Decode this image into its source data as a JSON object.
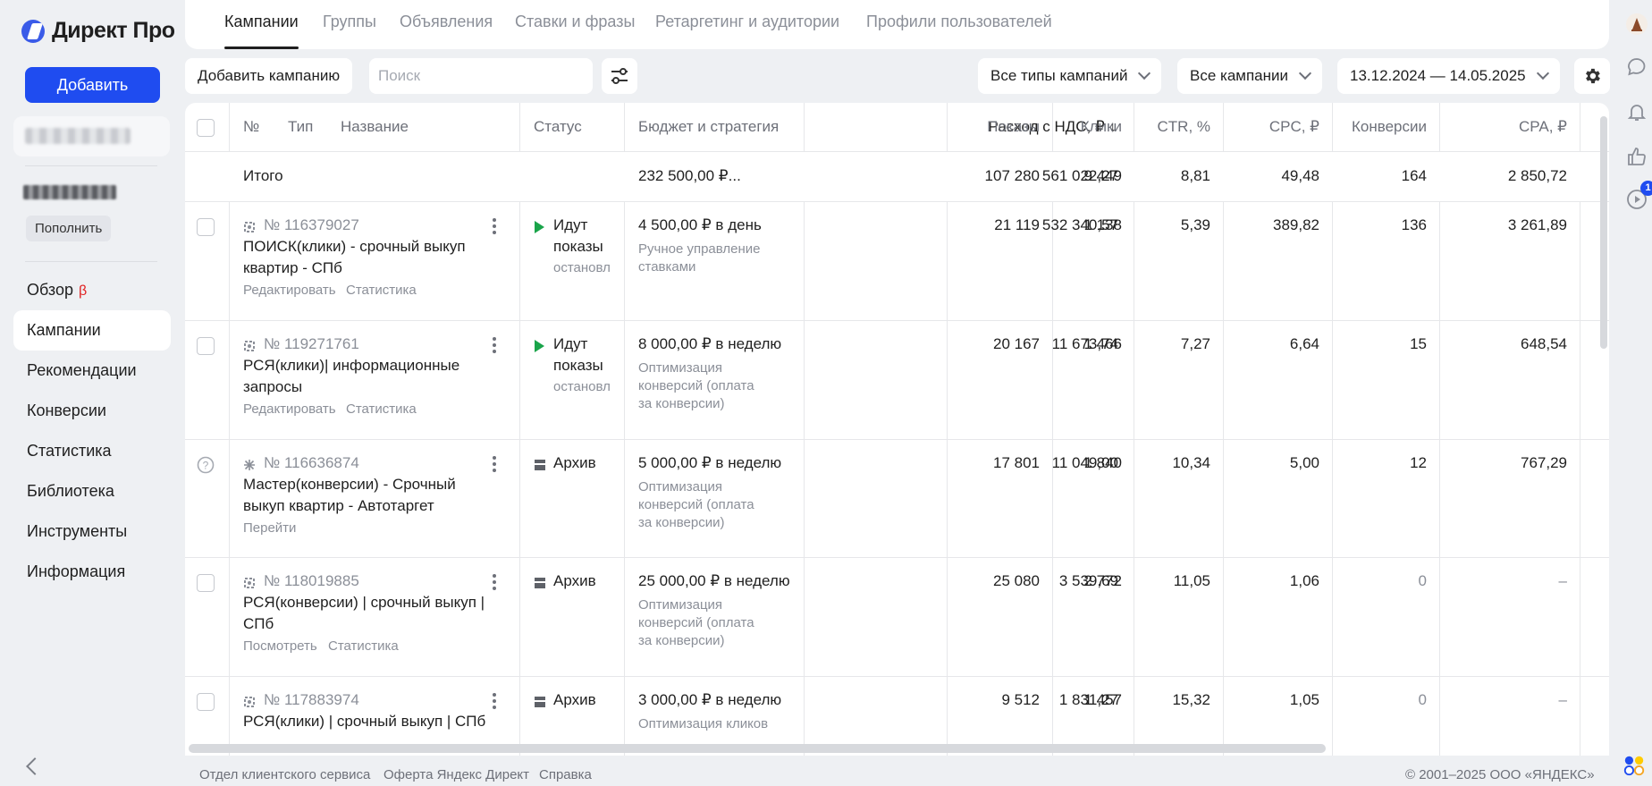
{
  "app": {
    "logo_text": "Директ Про",
    "add_button": "Добавить",
    "topup_button": "Пополнить"
  },
  "sidebar": {
    "items": [
      {
        "label": "Обзор",
        "badge": "β"
      },
      {
        "label": "Кампании",
        "active": true
      },
      {
        "label": "Рекомендации"
      },
      {
        "label": "Конверсии"
      },
      {
        "label": "Статистика"
      },
      {
        "label": "Библиотека"
      },
      {
        "label": "Инструменты"
      },
      {
        "label": "Информация"
      }
    ]
  },
  "tabs": [
    "Кампании",
    "Группы",
    "Объявления",
    "Ставки и фразы",
    "Ретаргетинг и аудитории",
    "Профили пользователей"
  ],
  "toolbar": {
    "add_campaign": "Добавить кампанию",
    "search_placeholder": "Поиск",
    "campaign_types": "Все типы кампаний",
    "campaigns_filter": "Все кампании",
    "date_range": "13.12.2024 — 14.05.2025"
  },
  "table": {
    "headers": {
      "num": "№",
      "type": "Тип",
      "name": "Название",
      "status": "Статус",
      "budget": "Бюджет и стратегия",
      "spend": "Расход с НДС, ₽ ↓",
      "impressions": "Показы",
      "clicks": "Клики",
      "ctr": "CTR, %",
      "cpc": "CPC, ₽",
      "conversions": "Конверсии",
      "cpa": "CPA, ₽"
    },
    "total": {
      "label": "Итого",
      "budget": "232 500,00 ₽...",
      "spend": "561 022,27",
      "impressions": "107 280",
      "clicks": "9 449",
      "ctr": "8,81",
      "cpc": "49,48",
      "conversions": "164",
      "cpa": "2 850,72"
    },
    "rows": [
      {
        "id": "№ 116379027",
        "name_line1": "ПОИСК(клики) - срочный выкуп",
        "name_line2": "квартир - СПб",
        "action1": "Редактировать",
        "action2": "Статистика",
        "status_line1": "Идут",
        "status_line2": "показы",
        "status_sub": "остановл",
        "budget": "4 500,00 ₽ в день",
        "strategy": [
          "Ручное управление",
          "ставками"
        ],
        "spend": "532 340,57",
        "impressions": "21 119",
        "clicks": "1 138",
        "ctr": "5,39",
        "cpc": "389,82",
        "conversions": "136",
        "cpa": "3 261,89"
      },
      {
        "id": "№ 119271761",
        "name_line1": "РСЯ(клики)| информационные",
        "name_line2": "запросы",
        "action1": "Редактировать",
        "action2": "Статистика",
        "status_line1": "Идут",
        "status_line2": "показы",
        "status_sub": "остановл",
        "budget": "8 000,00 ₽ в неделю",
        "strategy": [
          "Оптимизация",
          "конверсий (оплата",
          "за конверсии)"
        ],
        "spend": "11 673,74",
        "impressions": "20 167",
        "clicks": "1 466",
        "ctr": "7,27",
        "cpc": "6,64",
        "conversions": "15",
        "cpa": "648,54"
      },
      {
        "id": "№ 116636874",
        "name_line1": "Мастер(конверсии) - Срочный",
        "name_line2": "выкуп квартир - Автотаргет",
        "action1": "Перейти",
        "action2": "",
        "status_line1": "Архив",
        "budget": "5 000,00 ₽ в неделю",
        "strategy": [
          "Оптимизация",
          "конверсий (оплата",
          "за конверсии)"
        ],
        "spend": "11 049,00",
        "impressions": "17 801",
        "clicks": "1 840",
        "ctr": "10,34",
        "cpc": "5,00",
        "conversions": "12",
        "cpa": "767,29"
      },
      {
        "id": "№ 118019885",
        "name_line1": "РСЯ(конверсии) | срочный выкуп |",
        "name_line2": "СПб",
        "action1": "Посмотреть",
        "action2": "Статистика",
        "status_line1": "Архив",
        "budget": "25 000,00 ₽ в неделю",
        "strategy": [
          "Оптимизация",
          "конверсий (оплата",
          "за конверсии)"
        ],
        "spend": "3 539,69",
        "impressions": "25 080",
        "clicks": "2 772",
        "ctr": "11,05",
        "cpc": "1,06",
        "conversions": "0",
        "cpa": "–"
      },
      {
        "id": "№ 117883974",
        "name_line1": "РСЯ(клики) | срочный выкуп | СПб",
        "name_line2": "",
        "action1": "",
        "action2": "",
        "status_line1": "Архив",
        "budget": "3 000,00 ₽ в неделю",
        "strategy": [
          "Оптимизация кликов"
        ],
        "spend": "1 831,27",
        "impressions": "9 512",
        "clicks": "1 457",
        "ctr": "15,32",
        "cpc": "1,05",
        "conversions": "0",
        "cpa": "–"
      }
    ]
  },
  "footer": {
    "link1": "Отдел клиентского сервиса",
    "link2": "Оферта Яндекс Директ",
    "link3": "Справка",
    "copyright": "© 2001–2025 ООО «ЯНДЕКС»"
  },
  "rail": {
    "notifications_badge": "1"
  },
  "colors": {
    "accent": "#1f4cf0",
    "running": "#1aa44a",
    "beta": "#e02020"
  }
}
